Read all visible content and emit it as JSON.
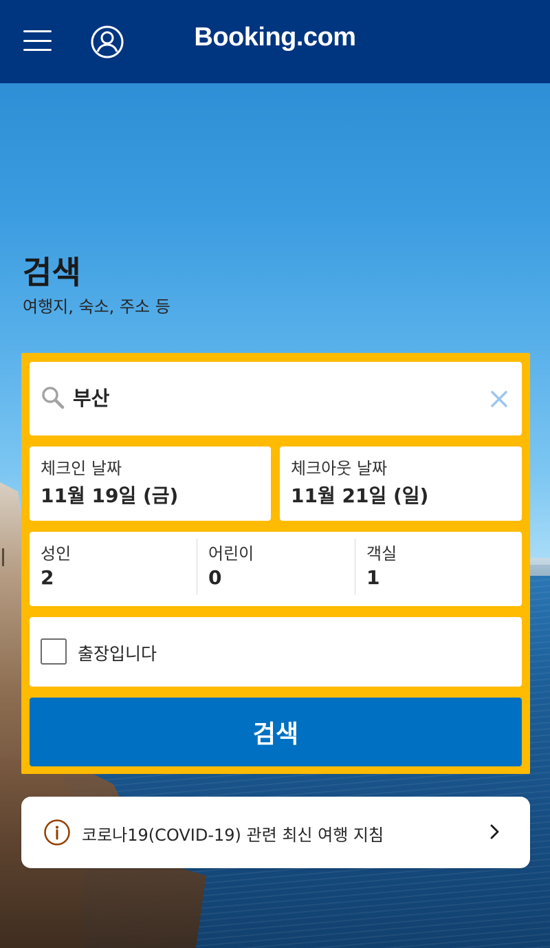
{
  "header": {
    "logo_text": "Booking.com",
    "background_color": "#003580",
    "icons": [
      "hamburger-menu-icon",
      "account-icon"
    ]
  },
  "hero": {
    "title": "검색",
    "subtitle": "여행지, 숙소, 주소 등"
  },
  "search_form": {
    "accent_color": "#febb02",
    "destination": {
      "value": "부산",
      "icons": [
        "search-icon",
        "clear-icon"
      ]
    },
    "checkin": {
      "label": "체크인 날짜",
      "value": "11월 19일 (금)"
    },
    "checkout": {
      "label": "체크아웃 날짜",
      "value": "11월 21일 (일)"
    },
    "adults": {
      "label": "성인",
      "value": "2"
    },
    "children": {
      "label": "어린이",
      "value": "0"
    },
    "rooms": {
      "label": "객실",
      "value": "1"
    },
    "business_trip": {
      "label": "출장입니다",
      "checked": false
    },
    "search_button": {
      "label": "검색",
      "color": "#0071c2"
    }
  },
  "covid_banner": {
    "text": "코로나19(COVID-19) 관련 최신 여행 지침",
    "icons": [
      "info-icon",
      "chevron-right-icon"
    ]
  }
}
